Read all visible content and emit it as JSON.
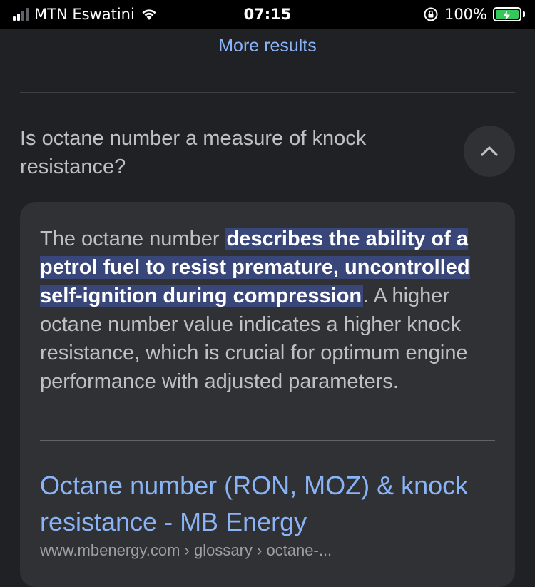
{
  "status_bar": {
    "carrier": "MTN Eswatini",
    "time": "07:15",
    "battery": "100%",
    "signal_bars_filled": 2,
    "signal_bars_total": 4
  },
  "more_results_label": "More results",
  "question": {
    "text": "Is octane number a measure of knock resistance?",
    "expanded": true,
    "toggle_icon": "chevron-up-icon"
  },
  "answer": {
    "lead": "The octane number ",
    "highlight": "describes the ability of a petrol fuel to resist premature, uncontrolled self-ignition during compression",
    "rest": ". A higher octane number value indicates a higher knock resistance, which is crucial for optimum engine performance with adjusted parameters."
  },
  "source": {
    "title": "Octane number (RON, MOZ) & knock resistance - MB Energy",
    "url": "www.mbenergy.com › glossary › octane-..."
  },
  "colors": {
    "background": "#202124",
    "card": "#303134",
    "link": "#8ab4f8",
    "highlight": "#394679",
    "battery_fill": "#34c759"
  }
}
